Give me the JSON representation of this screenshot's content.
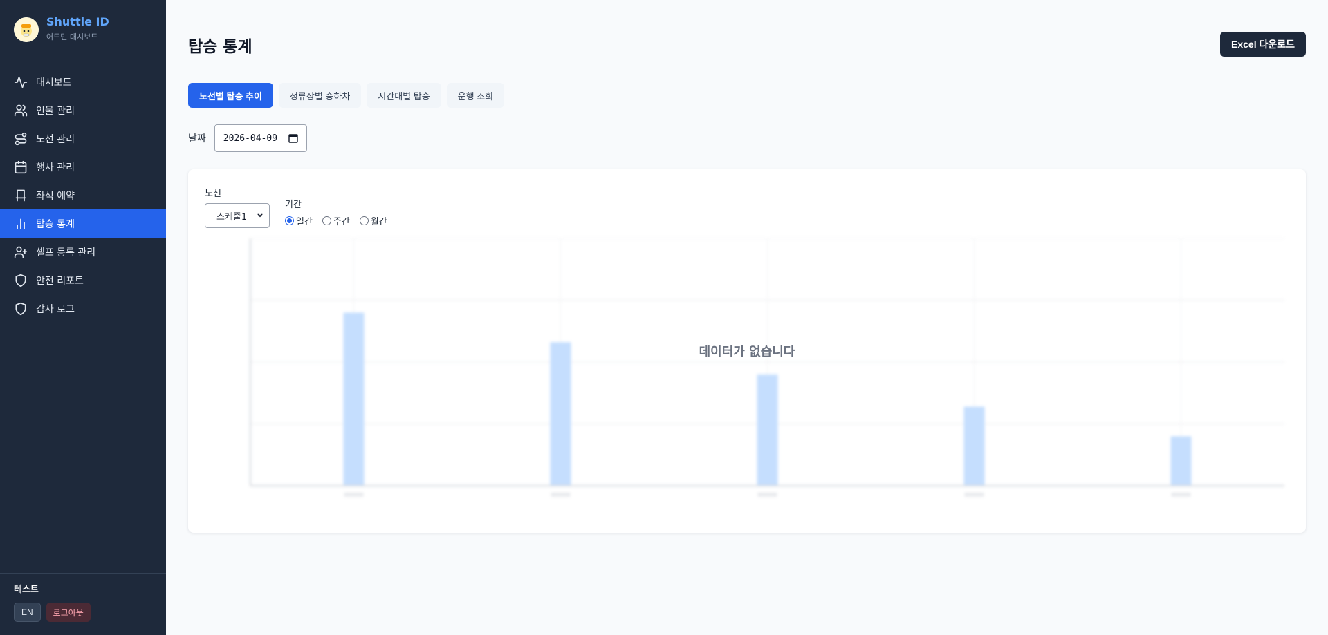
{
  "brand": {
    "title": "Shuttle ID",
    "subtitle": "어드민 대시보드",
    "avatar_icon": "user-avatar-icon"
  },
  "sidebar": {
    "items": [
      {
        "label": "대시보드",
        "icon": "activity-icon",
        "active": false
      },
      {
        "label": "인물 관리",
        "icon": "users-icon",
        "active": false
      },
      {
        "label": "노선 관리",
        "icon": "route-icon",
        "active": false
      },
      {
        "label": "행사 관리",
        "icon": "calendar-icon",
        "active": false
      },
      {
        "label": "좌석 예약",
        "icon": "seat-icon",
        "active": false
      },
      {
        "label": "탑승 통계",
        "icon": "bar-chart-icon",
        "active": true
      },
      {
        "label": "셀프 등록 관리",
        "icon": "user-plus-icon",
        "active": false
      },
      {
        "label": "안전 리포트",
        "icon": "shield-icon",
        "active": false
      },
      {
        "label": "감사 로그",
        "icon": "shield-icon",
        "active": false
      }
    ],
    "footer": {
      "user_name": "테스트",
      "lang_button": "EN",
      "logout_button": "로그아웃"
    }
  },
  "header": {
    "title": "탑승 통계",
    "excel_button": "Excel 다운로드"
  },
  "tabs": [
    {
      "label": "노선별 탑승 추이",
      "active": true
    },
    {
      "label": "정류장별 승하차",
      "active": false
    },
    {
      "label": "시간대별 탑승",
      "active": false
    },
    {
      "label": "운행 조회",
      "active": false
    }
  ],
  "date_filter": {
    "label": "날짜",
    "value": "2026-04-09"
  },
  "card": {
    "route_label": "노선",
    "route_value": "스케줄1",
    "period_label": "기간",
    "period_options": [
      {
        "label": "일간",
        "checked": true
      },
      {
        "label": "주간",
        "checked": false
      },
      {
        "label": "월간",
        "checked": false
      }
    ],
    "empty_message": "데이터가 없습니다"
  },
  "colors": {
    "accent": "#2563eb",
    "sidebar_bg": "#1e293b",
    "placeholder_bar": "#bfdbfe"
  },
  "chart_data": {
    "type": "bar",
    "note_visible_state": "blurred placeholder skeleton behind empty-state message",
    "categories": [
      "",
      "",
      "",
      "",
      ""
    ],
    "values": [
      70,
      58,
      45,
      32,
      20
    ],
    "ylim": [
      0,
      100
    ],
    "grid": true
  }
}
